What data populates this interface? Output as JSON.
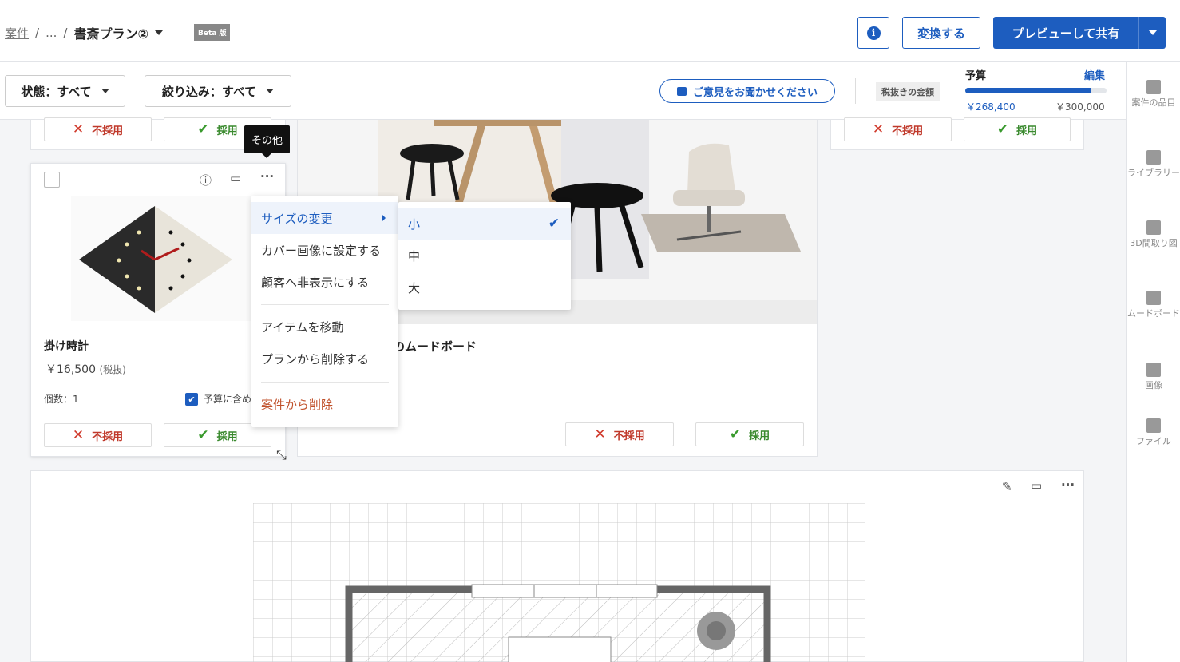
{
  "header": {
    "breadcrumb_root": "案件",
    "breadcrumb_sep1": "/",
    "breadcrumb_ellipsis": "...",
    "breadcrumb_sep2": "/",
    "plan_name": "書斎プラン②",
    "beta_label": "Beta 版",
    "info_label": "i",
    "convert_label": "変換する",
    "share_label": "プレビューして共有"
  },
  "filters": {
    "status_label": "状態：すべて",
    "narrow_label": "絞り込み：すべて",
    "feedback_label": "ご意見をお聞かせください",
    "tax_chip": "税抜きの金額"
  },
  "budget": {
    "label": "予算",
    "edit": "編集",
    "used": "￥268,400",
    "total": "￥300,000",
    "progress_percent": 89.5
  },
  "sidebar": {
    "items": [
      {
        "label": "案件の品目",
        "icon": "item-icon"
      },
      {
        "label": "ライブラリー",
        "icon": "library-icon"
      },
      {
        "label": "3D間取り図",
        "icon": "floorplan-3d-icon"
      },
      {
        "label": "ムードボード",
        "icon": "moodboard-icon"
      },
      {
        "label": "画像",
        "icon": "image-icon"
      },
      {
        "label": "ファイル",
        "icon": "file-icon"
      }
    ]
  },
  "actions": {
    "reject": "不採用",
    "accept": "採用"
  },
  "tooltip": "その他",
  "item": {
    "name": "掛け時計",
    "price": "￥16,500",
    "price_note": "(税抜)",
    "qty": "個数：1",
    "include_budget": "予算に含め"
  },
  "context_menu": {
    "items": [
      "サイズの変更",
      "カバー画像に設定する",
      "顧客へ非表示にする",
      "アイテムを移動",
      "プランから削除する",
      "案件から削除"
    ]
  },
  "size_submenu": {
    "items": [
      "小",
      "中",
      "大"
    ],
    "selected": "小"
  },
  "moodboard": {
    "title": "のムードボード"
  },
  "colors": {
    "primary": "#1d5dbf",
    "reject": "#c0392b",
    "accept": "#3a8a2e"
  }
}
